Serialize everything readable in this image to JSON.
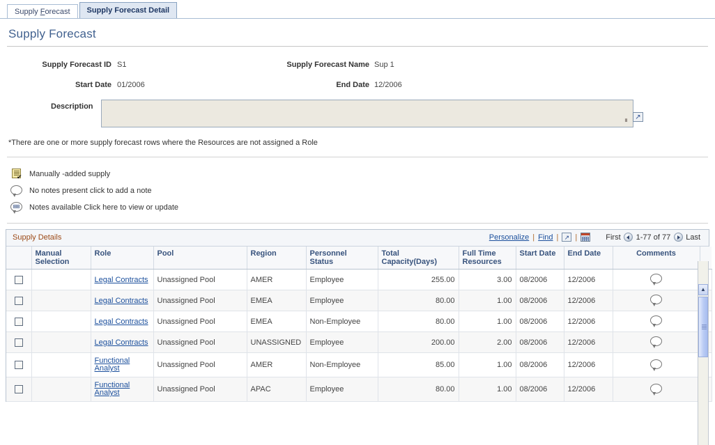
{
  "tabs": [
    {
      "label": "Supply Forecast",
      "accel": "F",
      "active": false
    },
    {
      "label": "Supply Forecast Detail",
      "accel": "",
      "active": true
    }
  ],
  "page_title": "Supply Forecast",
  "fields": {
    "supply_forecast_id_label": "Supply Forecast ID",
    "supply_forecast_id_value": "S1",
    "supply_forecast_name_label": "Supply Forecast Name",
    "supply_forecast_name_value": "Sup 1",
    "start_date_label": "Start Date",
    "start_date_value": "01/2006",
    "end_date_label": "End Date",
    "end_date_value": "12/2006"
  },
  "description": {
    "label": "Description",
    "value": "",
    "placeholder": "",
    "expand_icon": "expand-icon"
  },
  "warning_note": "*There are one or more supply forecast rows where the Resources are not assigned a Role",
  "legend": [
    {
      "icon": "manual-supply-icon",
      "text": "Manually -added supply"
    },
    {
      "icon": "empty-note-bubble-icon",
      "text": "No notes present click to add a note"
    },
    {
      "icon": "filled-note-bubble-icon",
      "text": "Notes available Click here to view or update"
    }
  ],
  "grid": {
    "title": "Supply Details",
    "personalize_label": "Personalize",
    "find_label": "Find",
    "separator": "|",
    "download_icon": "download-to-excel-icon",
    "view_all_icon": "view-grid-icon",
    "first_label": "First",
    "last_label": "Last",
    "prev_icon": "previous-page-icon",
    "next_icon": "next-page-icon",
    "range_label": "1-77 of 77",
    "columns": [
      {
        "label": "",
        "name": "select"
      },
      {
        "label": "Manual\nSelection",
        "name": "manual-selection"
      },
      {
        "label": "Role",
        "name": "role"
      },
      {
        "label": "Pool",
        "name": "pool"
      },
      {
        "label": "Region",
        "name": "region"
      },
      {
        "label": "Personnel\nStatus",
        "name": "personnel-status"
      },
      {
        "label": "Total\nCapacity(Days)",
        "name": "total-capacity-days"
      },
      {
        "label": "Full Time\nResources",
        "name": "full-time-resources"
      },
      {
        "label": "Start Date",
        "name": "start-date"
      },
      {
        "label": "End Date",
        "name": "end-date"
      },
      {
        "label": "Comments",
        "name": "comments"
      }
    ],
    "rows": [
      {
        "selected": false,
        "manual": "",
        "role": "Legal Contracts",
        "pool": "Unassigned Pool",
        "region": "AMER",
        "personnel_status": "Employee",
        "total_capacity": "255.00",
        "full_time_resources": "3.00",
        "start_date": "08/2006",
        "end_date": "12/2006",
        "comment_icon": "empty-note-bubble-icon"
      },
      {
        "selected": false,
        "manual": "",
        "role": "Legal Contracts",
        "pool": "Unassigned Pool",
        "region": "EMEA",
        "personnel_status": "Employee",
        "total_capacity": "80.00",
        "full_time_resources": "1.00",
        "start_date": "08/2006",
        "end_date": "12/2006",
        "comment_icon": "empty-note-bubble-icon"
      },
      {
        "selected": false,
        "manual": "",
        "role": "Legal Contracts",
        "pool": "Unassigned Pool",
        "region": "EMEA",
        "personnel_status": "Non-Employee",
        "total_capacity": "80.00",
        "full_time_resources": "1.00",
        "start_date": "08/2006",
        "end_date": "12/2006",
        "comment_icon": "empty-note-bubble-icon"
      },
      {
        "selected": false,
        "manual": "",
        "role": "Legal Contracts",
        "pool": "Unassigned Pool",
        "region": "UNASSIGNED",
        "personnel_status": "Employee",
        "total_capacity": "200.00",
        "full_time_resources": "2.00",
        "start_date": "08/2006",
        "end_date": "12/2006",
        "comment_icon": "empty-note-bubble-icon"
      },
      {
        "selected": false,
        "manual": "",
        "role": "Functional Analyst",
        "pool": "Unassigned Pool",
        "region": "AMER",
        "personnel_status": "Non-Employee",
        "total_capacity": "85.00",
        "full_time_resources": "1.00",
        "start_date": "08/2006",
        "end_date": "12/2006",
        "comment_icon": "empty-note-bubble-icon"
      },
      {
        "selected": false,
        "manual": "",
        "role": "Functional Analyst",
        "pool": "Unassigned Pool",
        "region": "APAC",
        "personnel_status": "Employee",
        "total_capacity": "80.00",
        "full_time_resources": "1.00",
        "start_date": "08/2006",
        "end_date": "12/2006",
        "comment_icon": "empty-note-bubble-icon"
      }
    ]
  },
  "colors": {
    "title_blue": "#41618f",
    "link_blue": "#1b4f9c",
    "grid_title_orange": "#9c4a17",
    "header_text_blue": "#38537d",
    "active_tab_bg": "#dfe7f2",
    "field_bg": "#ece9e0"
  }
}
